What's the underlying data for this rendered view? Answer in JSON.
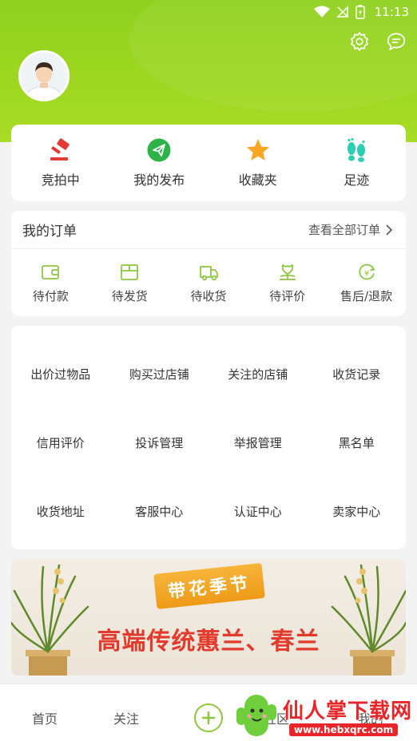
{
  "status_bar": {
    "time": "11:13"
  },
  "quick_actions": [
    {
      "label": "竞拍中",
      "icon": "gavel-icon"
    },
    {
      "label": "我的发布",
      "icon": "paper-plane-icon"
    },
    {
      "label": "收藏夹",
      "icon": "star-icon"
    },
    {
      "label": "足迹",
      "icon": "footprint-icon"
    }
  ],
  "orders": {
    "title": "我的订单",
    "view_all": "查看全部订单",
    "items": [
      {
        "label": "待付款",
        "icon": "wallet-icon"
      },
      {
        "label": "待发货",
        "icon": "package-icon"
      },
      {
        "label": "待收货",
        "icon": "truck-icon"
      },
      {
        "label": "待评价",
        "icon": "flower-icon"
      },
      {
        "label": "售后/退款",
        "icon": "refund-icon"
      }
    ]
  },
  "tools": [
    "出价过物品",
    "购买过店铺",
    "关注的店铺",
    "收货记录",
    "信用评价",
    "投诉管理",
    "举报管理",
    "黑名单",
    "收货地址",
    "客服中心",
    "认证中心",
    "卖家中心"
  ],
  "banner": {
    "tag": "带花季节",
    "title": "高端传统蕙兰、春兰"
  },
  "tabbar": {
    "home": "首页",
    "follow": "关注",
    "community": "社区",
    "mine": "我的"
  },
  "watermark": {
    "title": "仙人掌下载网",
    "url": "www.hebxqrc.com"
  },
  "colors": {
    "primary_green": "#9ed721",
    "accent_green": "#8dc63f",
    "icon_red": "#e53935",
    "icon_orange": "#f6a623",
    "icon_teal": "#2ccfb2"
  }
}
